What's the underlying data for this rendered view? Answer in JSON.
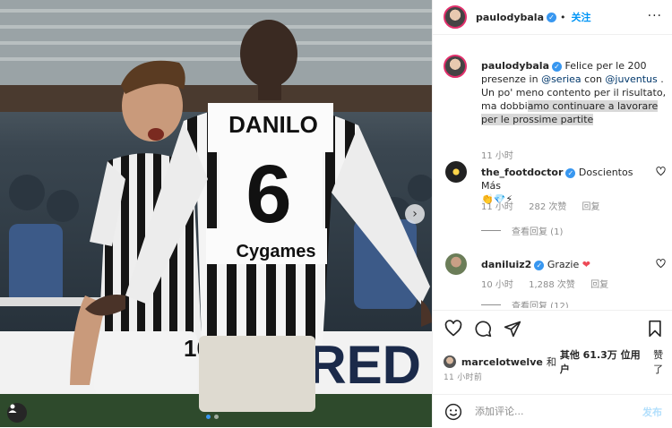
{
  "post": {
    "author": "paulodybala",
    "follow_label": "关注",
    "more_label": "···",
    "caption_parts": {
      "text1": "Felice per le 200 presenze in ",
      "mention1": "@seriea",
      "text2": " con ",
      "mention2": "@juventus",
      "text3": " . Un po' meno contento per il risultato, ma dobbi",
      "highlighted": "amo continuare a lavorare per le prossime partite"
    },
    "caption_time": "11 小时"
  },
  "photo": {
    "jersey_name": "DANILO",
    "jersey_number": "6",
    "sponsor": "Cygames",
    "back_number": "10",
    "banner_text": "RED"
  },
  "comments": [
    {
      "username": "the_footdoctor",
      "text": "Doscientos Más",
      "emojis": "👏💎⚡",
      "time": "11 小时",
      "likes": "282 次赞",
      "reply": "回复",
      "view_replies": "查看回复 (1)"
    },
    {
      "username": "daniluiz2",
      "text": "Grazie",
      "emoji": "❤",
      "time": "10 小时",
      "likes": "1,288 次赞",
      "reply": "回复",
      "view_replies": "查看回复 (12)"
    }
  ],
  "likes": {
    "user": "marcelotwelve",
    "and_label": "和",
    "others_label": "其他 61.3万 位用户",
    "suffix": "赞了"
  },
  "post_time": "11 小时前",
  "comment_box": {
    "placeholder": "添加评论...",
    "post_label": "发布"
  },
  "icons": {
    "like": "heart-icon",
    "comment": "comment-icon",
    "share": "paper-plane-icon",
    "save": "bookmark-icon",
    "emoji": "smiley-icon",
    "next": "chevron-right-icon",
    "tag": "user-tag-icon"
  },
  "colors": {
    "accent_blue": "#0095f6",
    "verified": "#3897f0",
    "heart_red": "#ed4956",
    "juve_black": "#111111"
  }
}
